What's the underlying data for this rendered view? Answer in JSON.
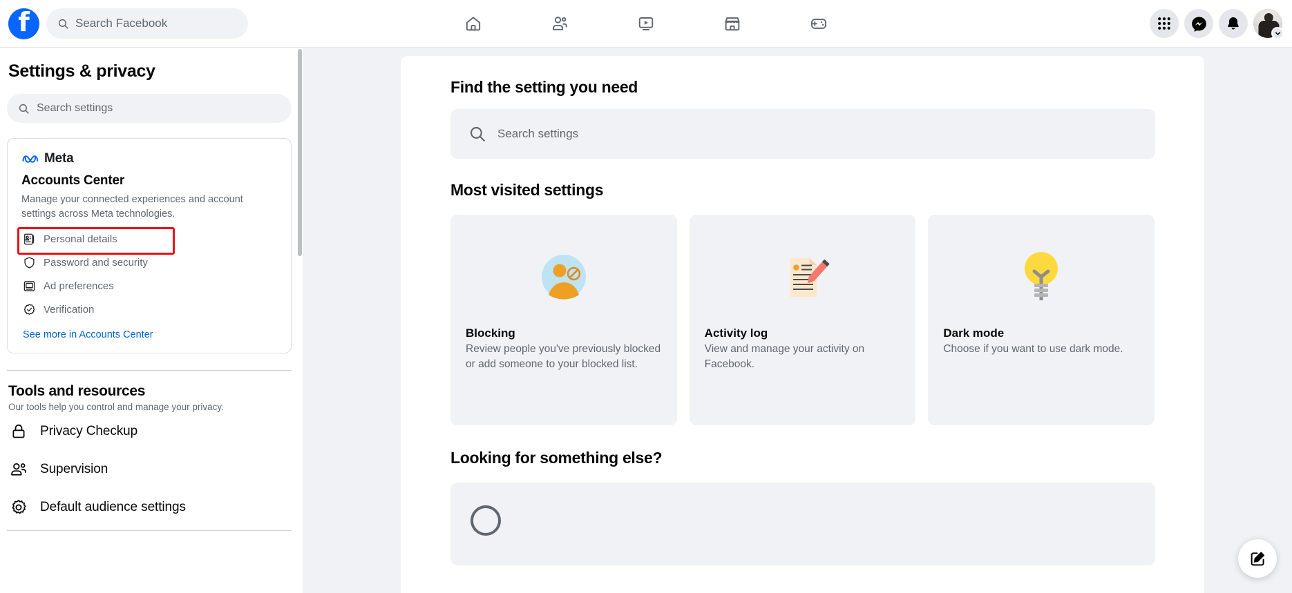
{
  "topbar": {
    "logo_icon": "facebook-logo-icon",
    "search": {
      "placeholder": "Search Facebook",
      "icon": "search-icon"
    },
    "nav_tabs": [
      {
        "name": "home",
        "icon": "home-icon"
      },
      {
        "name": "friends",
        "icon": "friends-icon"
      },
      {
        "name": "video",
        "icon": "video-play-icon"
      },
      {
        "name": "marketplace",
        "icon": "marketplace-storefront-icon"
      },
      {
        "name": "gaming",
        "icon": "gaming-controller-icon"
      }
    ],
    "right_actions": [
      {
        "name": "menu",
        "icon": "grid-menu-icon"
      },
      {
        "name": "messenger",
        "icon": "messenger-icon"
      },
      {
        "name": "notifications",
        "icon": "bell-icon"
      },
      {
        "name": "account",
        "icon": "avatar-icon",
        "badge_icon": "chevron-down-icon"
      }
    ]
  },
  "sidebar": {
    "title": "Settings & privacy",
    "search": {
      "placeholder": "Search settings",
      "icon": "search-icon"
    },
    "accounts_center": {
      "brand": "Meta",
      "brand_icon": "meta-infinity-icon",
      "title": "Accounts Center",
      "description": "Manage your connected experiences and account settings across Meta technologies.",
      "items": [
        {
          "label": "Personal details",
          "icon": "id-card-icon",
          "highlighted": true
        },
        {
          "label": "Password and security",
          "icon": "shield-icon",
          "highlighted": false
        },
        {
          "label": "Ad preferences",
          "icon": "monitor-icon",
          "highlighted": false
        },
        {
          "label": "Verification",
          "icon": "verified-check-icon",
          "highlighted": false
        }
      ],
      "see_more": "See more in Accounts Center",
      "highlight_color": "#ee1111",
      "link_color": "#0064d1"
    },
    "tools": {
      "title": "Tools and resources",
      "subtitle": "Our tools help you control and manage your privacy.",
      "items": [
        {
          "label": "Privacy Checkup",
          "icon": "lock-icon"
        },
        {
          "label": "Supervision",
          "icon": "people-icon"
        },
        {
          "label": "Default audience settings",
          "icon": "gear-icon"
        }
      ]
    }
  },
  "main": {
    "find_section": {
      "title": "Find the setting you need",
      "search": {
        "placeholder": "Search settings",
        "icon": "search-icon"
      }
    },
    "most_visited": {
      "title": "Most visited settings",
      "tiles": [
        {
          "name": "Blocking",
          "description": "Review people you've previously blocked or add someone to your blocked list.",
          "icon": "blocked-person-icon"
        },
        {
          "name": "Activity log",
          "description": "View and manage your activity on Facebook.",
          "icon": "document-pencil-icon"
        },
        {
          "name": "Dark mode",
          "description": "Choose if you want to use dark mode.",
          "icon": "lightbulb-icon"
        }
      ]
    },
    "looking_for": {
      "title": "Looking for something else?"
    }
  },
  "fab": {
    "icon": "compose-edit-icon"
  },
  "colors": {
    "brand_blue": "#0866ff",
    "page_bg": "#f0f2f5",
    "surface": "#ffffff",
    "text_primary": "#080809",
    "text_secondary": "#606770",
    "highlight_red": "#ee1111",
    "link_blue": "#0064d1"
  }
}
